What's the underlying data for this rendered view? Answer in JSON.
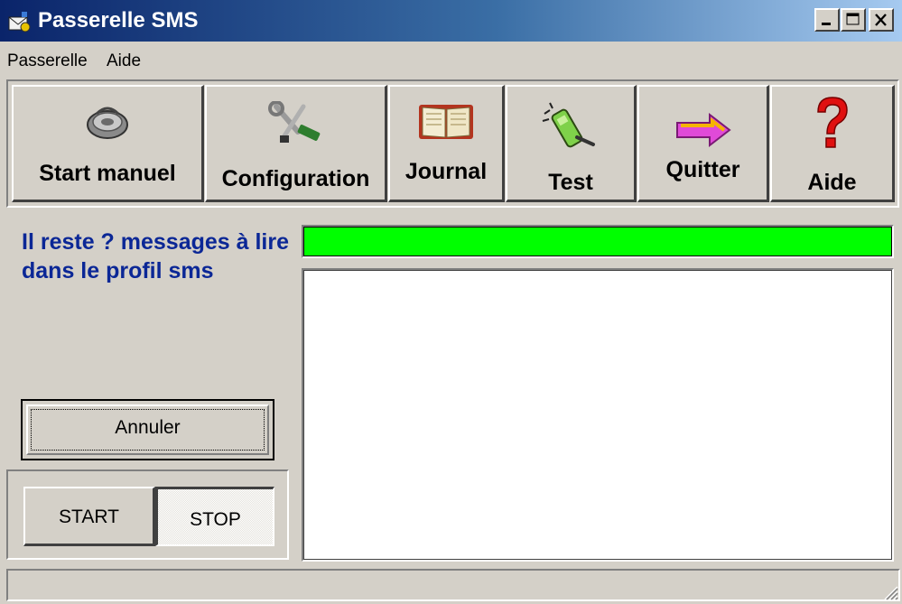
{
  "window": {
    "title": "Passerelle SMS",
    "controls": {
      "minimize": "minimize",
      "maximize": "maximize",
      "close": "close"
    }
  },
  "menu": {
    "items": [
      {
        "label": "Passerelle"
      },
      {
        "label": "Aide"
      }
    ]
  },
  "toolbar": {
    "buttons": [
      {
        "label": "Start manuel",
        "icon": "phone-disc-icon"
      },
      {
        "label": "Configuration",
        "icon": "tools-icon"
      },
      {
        "label": "Journal",
        "icon": "book-icon"
      },
      {
        "label": "Test",
        "icon": "cellphone-icon"
      },
      {
        "label": "Quitter",
        "icon": "arrow-right-icon"
      },
      {
        "label": "Aide",
        "icon": "question-mark-icon"
      }
    ]
  },
  "status": {
    "message": "Il reste ? messages à lire dans le profil sms"
  },
  "actions": {
    "cancel_label": "Annuler",
    "start_label": "START",
    "stop_label": "STOP",
    "stop_pressed": true
  },
  "progress": {
    "percent": 100,
    "color": "#00ff00"
  },
  "log": {
    "content": ""
  },
  "statusbar": {
    "text": ""
  },
  "colors": {
    "status_text": "#0b2796",
    "face": "#d4d0c8"
  }
}
